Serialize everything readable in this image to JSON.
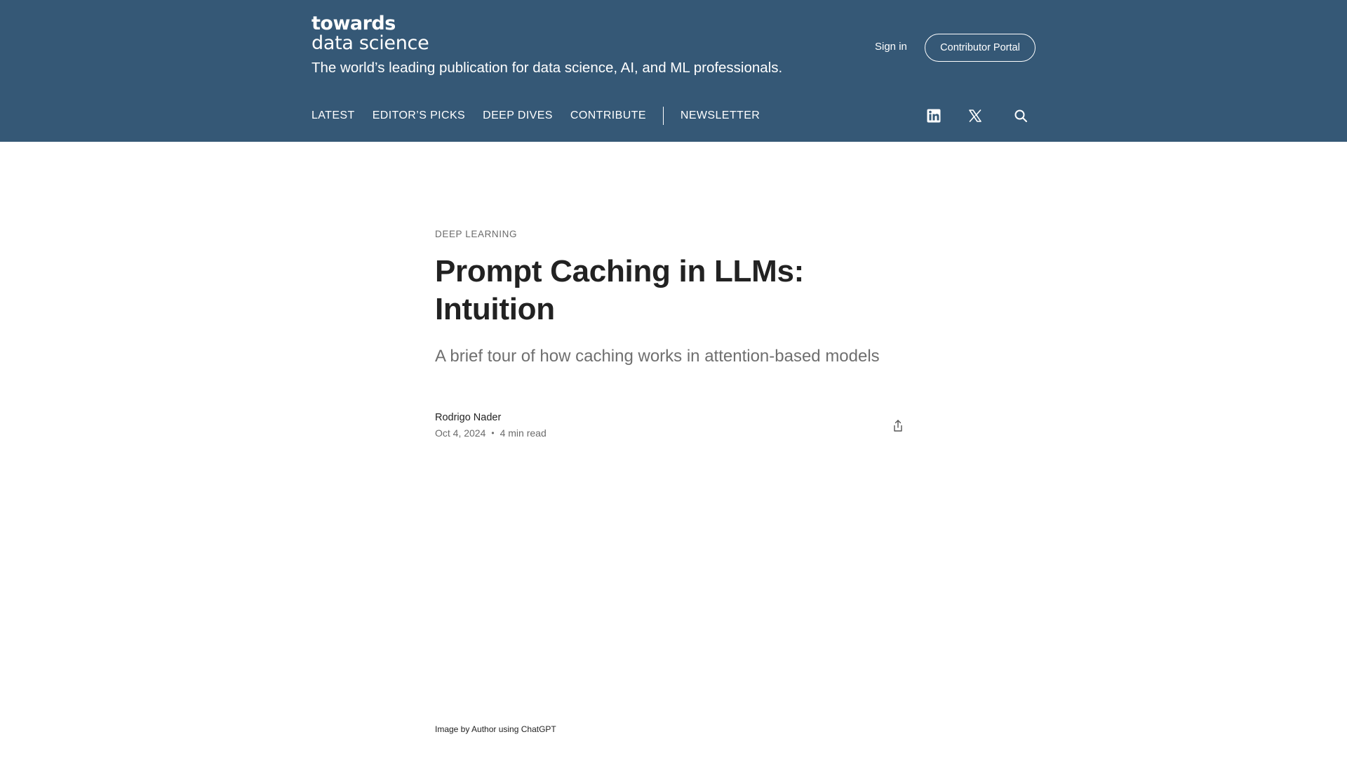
{
  "header": {
    "logo_top": "towards",
    "logo_bottom": "data science",
    "tagline": "The world’s leading publication for data science, AI, and ML professionals.",
    "sign_in": "Sign in",
    "contributor_portal": "Contributor Portal",
    "bg_color": "#355876"
  },
  "nav": {
    "items": [
      "LATEST",
      "EDITOR’S PICKS",
      "DEEP DIVES",
      "CONTRIBUTE",
      "NEWSLETTER"
    ]
  },
  "icons": {
    "linkedin": "linkedin-icon",
    "x": "x-twitter-icon",
    "search": "search-icon",
    "share": "share-icon"
  },
  "article": {
    "category": "DEEP LEARNING",
    "title": "Prompt Caching in LLMs: Intuition",
    "subtitle": "A brief tour of how caching works in attention-based models",
    "author": "Rodrigo Nader",
    "date": "Oct 4, 2024",
    "separator": "•",
    "read_time": "4 min read",
    "image_caption": "Image by Author using ChatGPT"
  }
}
